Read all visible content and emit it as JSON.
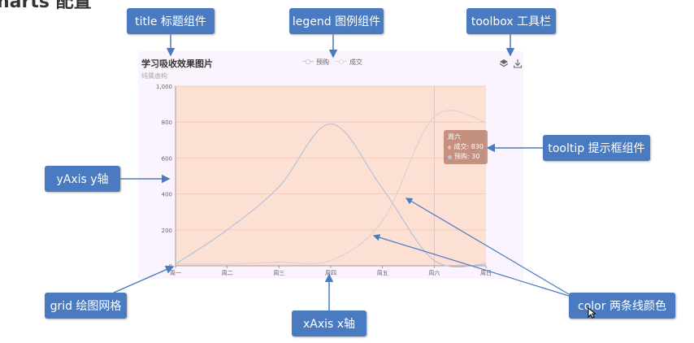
{
  "page": {
    "heading": "harts 配置"
  },
  "callouts": {
    "title": "title 标题组件",
    "legend": "legend 图例组件",
    "toolbox": "toolbox 工具栏",
    "tooltip": "tooltip 提示框组件",
    "yaxis": "yAxis y轴",
    "grid": "grid 绘图网格",
    "xaxis": "xAxis x轴",
    "color": "color 两条线颜色"
  },
  "toolbox": {
    "icons": [
      "layers-icon",
      "download-icon"
    ]
  },
  "tooltip": {
    "header": "周六",
    "rows": [
      "成交: 830",
      "预购: 30"
    ]
  },
  "colors": {
    "grid_bg": "#fde0d4",
    "panel_bg": "#fbf3fd",
    "series_预购": "#b9c4dc",
    "series_成交": "#e6cfcf",
    "callout_bg": "#4a7bc1"
  },
  "chart_data": {
    "type": "line",
    "title": "学习吸收效果图片",
    "subtitle": "纯属虚构",
    "categories": [
      "周一",
      "周二",
      "周三",
      "周四",
      "周五",
      "周六",
      "周日"
    ],
    "series": [
      {
        "name": "预购",
        "values": [
          10,
          200,
          440,
          790,
          430,
          30,
          10
        ]
      },
      {
        "name": "成交",
        "values": [
          10,
          10,
          20,
          30,
          250,
          830,
          800
        ]
      }
    ],
    "ylim": [
      0,
      1000
    ],
    "yticks": [
      0,
      200,
      400,
      600,
      800,
      "1,000"
    ],
    "grid": true,
    "legend_position": "top-center",
    "smooth": true
  }
}
